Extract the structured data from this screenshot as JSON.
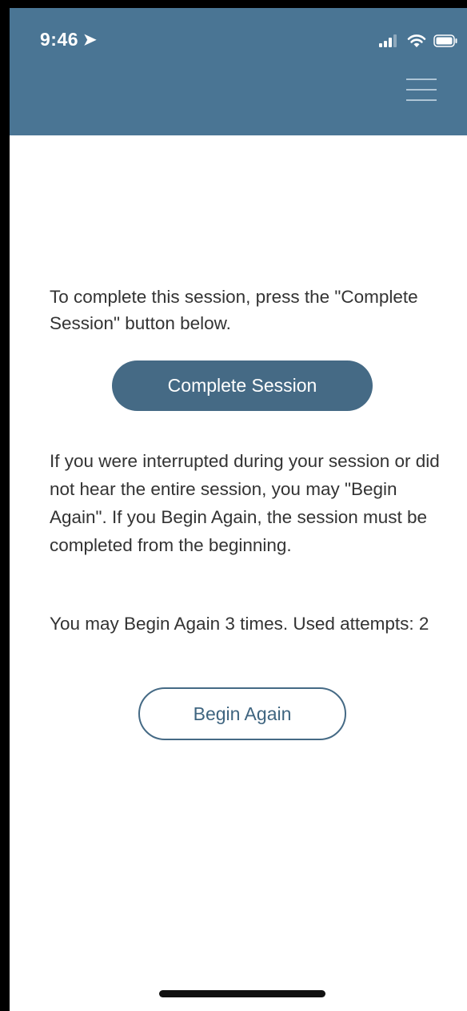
{
  "status_bar": {
    "time": "9:46",
    "location_icon": "location-arrow-icon",
    "signal_icon": "cellular-signal-icon",
    "wifi_icon": "wifi-icon",
    "battery_icon": "battery-icon"
  },
  "header": {
    "background": "#4a7594",
    "menu_icon": "hamburger-menu-icon"
  },
  "main": {
    "instruction": "To complete this session, press the \"Complete Session\" button below.",
    "complete_button_label": "Complete Session",
    "interrupted_text": "If you were interrupted during your session or did not hear the entire session, you may \"Begin Again\". If you Begin Again, the session must be completed from the beginning.",
    "attempts_text": "You may Begin Again 3 times. Used attempts: 2",
    "begin_again_button_label": "Begin Again"
  },
  "colors": {
    "accent": "#456a85",
    "text": "#333333"
  }
}
